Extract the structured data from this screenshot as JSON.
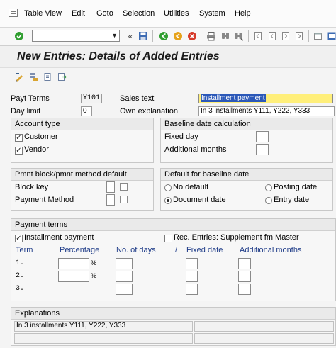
{
  "menu": {
    "items": [
      "Table View",
      "Edit",
      "Goto",
      "Selection",
      "Utilities",
      "System",
      "Help"
    ]
  },
  "page": {
    "title": "New Entries: Details of Added Entries"
  },
  "header": {
    "payt_terms_label": "Payt Terms",
    "payt_terms_value": "Y101",
    "day_limit_label": "Day limit",
    "day_limit_value": "0",
    "sales_text_label": "Sales text",
    "sales_text_value": "Installment payment",
    "own_expl_label": "Own explanation",
    "own_expl_value": "In 3 installments Y111, Y222, Y333"
  },
  "account_type": {
    "title": "Account type",
    "customer_label": "Customer",
    "customer_checked": true,
    "vendor_label": "Vendor",
    "vendor_checked": true
  },
  "baseline_calc": {
    "title": "Baseline date calculation",
    "fixed_day_label": "Fixed day",
    "additional_months_label": "Additional months"
  },
  "pmnt_block": {
    "title": "Pmnt block/pmnt method default",
    "block_key_label": "Block key",
    "payment_method_label": "Payment Method"
  },
  "default_baseline": {
    "title": "Default for baseline date",
    "no_default_label": "No default",
    "posting_date_label": "Posting date",
    "document_date_label": "Document date",
    "entry_date_label": "Entry date",
    "selected": "document_date"
  },
  "payment_terms": {
    "title": "Payment terms",
    "installment_label": "Installment payment",
    "installment_checked": true,
    "rec_entries_label": "Rec. Entries: Supplement fm Master",
    "rec_entries_checked": false,
    "columns": {
      "term": "Term",
      "percentage": "Percentage",
      "no_of_days": "No. of days",
      "slash": "/",
      "fixed_date": "Fixed date",
      "additional_months": "Additional months"
    },
    "rows": [
      {
        "term": "1.",
        "pct_symbol": "%"
      },
      {
        "term": "2.",
        "pct_symbol": "%"
      },
      {
        "term": "3.",
        "pct_symbol": ""
      }
    ]
  },
  "explanations": {
    "title": "Explanations",
    "line1": "In 3 installments Y111, Y222, Y333"
  },
  "colors": {
    "highlight": "#ffef7a",
    "selection": "#2b58b8",
    "enter_icon": "#2e9d2e",
    "back_icon": "#2e9d2e",
    "exit_icon": "#e6a21a",
    "cancel_icon": "#d63a2a"
  }
}
